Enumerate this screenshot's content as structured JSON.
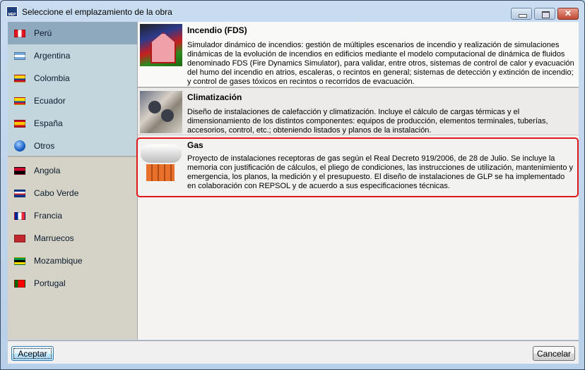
{
  "window": {
    "title": "Seleccione el emplazamiento de la obra",
    "app_icon_text": "MEP",
    "close_glyph": "✕"
  },
  "countries_primary": [
    {
      "name": "Perú",
      "flag": [
        "#e2141f",
        "#ffffff",
        "#e2141f"
      ],
      "selected": true
    },
    {
      "name": "Argentina",
      "flag": [
        "#75aadb",
        "#ffffff",
        "#75aadb"
      ]
    },
    {
      "name": "Colombia",
      "flag": [
        "#fcd116",
        "#fcd116",
        "#003893",
        "#ce1126"
      ]
    },
    {
      "name": "Ecuador",
      "flag": [
        "#ffdd00",
        "#ffdd00",
        "#034ea2",
        "#ed1c24"
      ]
    },
    {
      "name": "España",
      "flag": [
        "#c60b1e",
        "#ffc400",
        "#ffc400",
        "#c60b1e"
      ]
    },
    {
      "name": "Otros",
      "icon": "globe-icon"
    }
  ],
  "countries_secondary": [
    {
      "name": "Angola",
      "flag": [
        "#cc092f",
        "#000000"
      ]
    },
    {
      "name": "Cabo Verde",
      "flag": [
        "#003893",
        "#ffffff",
        "#cf2027",
        "#003893"
      ]
    },
    {
      "name": "Francia",
      "flag": [
        "#002395",
        "#ffffff",
        "#ed2939"
      ],
      "vertical": true
    },
    {
      "name": "Marruecos",
      "flag": [
        "#c1272d"
      ]
    },
    {
      "name": "Mozambique",
      "flag": [
        "#009a44",
        "#000000",
        "#fce100"
      ]
    },
    {
      "name": "Portugal",
      "flag": [
        "#006600",
        "#ff0000",
        "#ff0000"
      ],
      "vertical": true
    }
  ],
  "modules": [
    {
      "title": "Incendio (FDS)",
      "image": "fire-house-image",
      "description": "Simulador dinámico de incendios: gestión de múltiples escenarios de incendio y realización de simulaciones dinámicas de la evolución de incendios en edificios mediante el modelo computacional de dinámica de fluidos denominado FDS (Fire Dynamics Simulator), para validar, entre otros, sistemas de control de calor y evacuación del humo del incendio en atrios, escaleras, o recintos en general; sistemas de detección y extinción de incendio; y control de gases tóxicos en recintos o recorridos de evacuación."
    },
    {
      "title": "Climatización",
      "image": "hvac-units-image",
      "description": "Diseño de instalaciones de calefacción y climatización. Incluye el cálculo de cargas térmicas y el dimensionamiento de los distintos componentes: equipos de producción, elementos terminales, tuberías, accesorios, control, etc.; obteniendo listados y planos de la instalación."
    },
    {
      "title": "Gas",
      "image": "gas-tank-image",
      "selected": true,
      "description": "Proyecto de instalaciones receptoras de gas según el Real Decreto 919/2006, de 28 de Julio. Se incluye la memoria con justificación de cálculos, el pliego de condiciones, las instrucciones de utilización, mantenimiento y emergencia, los planos, la medición y el presupuesto. El diseño de instalaciones de GLP se ha implementado en colaboración con REPSOL y de acuerdo a sus especificaciones técnicas."
    }
  ],
  "footer": {
    "accept": "Aceptar",
    "cancel": "Cancelar"
  },
  "colors": {
    "selection_border": "#e01818",
    "sidebar_selected": "#8ea9bd"
  }
}
